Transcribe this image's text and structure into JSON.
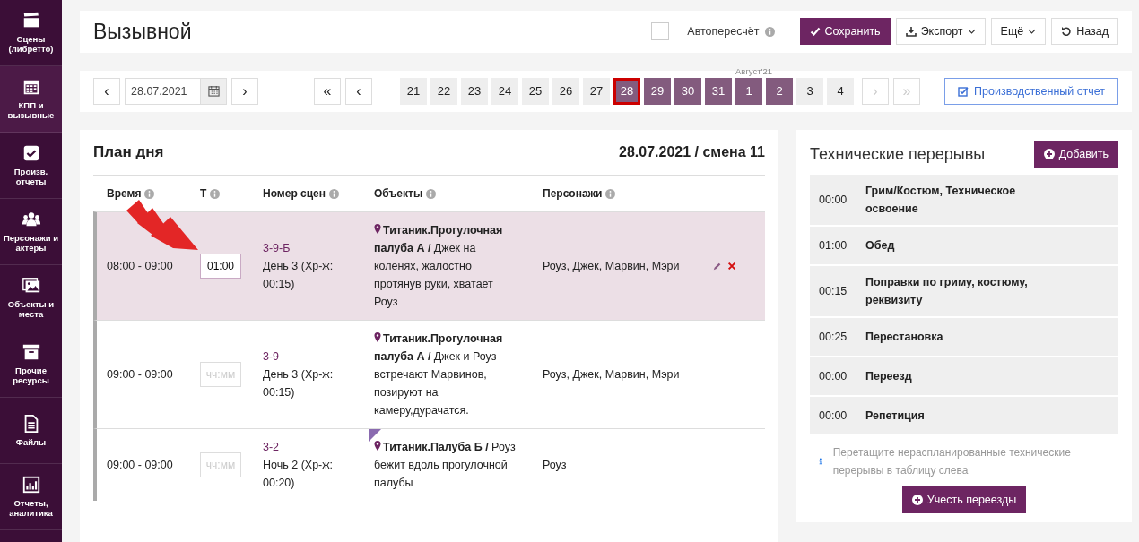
{
  "sidebar": {
    "items": [
      {
        "label": "Сцены (либретто)",
        "selected": false
      },
      {
        "label": "КПП и вызывные",
        "selected": true
      },
      {
        "label": "Произв. отчеты",
        "selected": false
      },
      {
        "label": "Персонажи и актеры",
        "selected": false
      },
      {
        "label": "Объекты и места",
        "selected": false
      },
      {
        "label": "Прочие ресурсы",
        "selected": false
      },
      {
        "label": "Файлы",
        "selected": false
      },
      {
        "label": "Отчеты, аналитика",
        "selected": false
      }
    ]
  },
  "header": {
    "title": "Вызывной",
    "autorecalc": {
      "label": "Автопересчёт",
      "checked": false
    },
    "buttons": [
      {
        "kind": "save",
        "label": "Сохранить"
      },
      {
        "kind": "export",
        "label": "Экспорт"
      },
      {
        "kind": "more",
        "label": "Ещё"
      },
      {
        "kind": "back",
        "label": "Назад"
      }
    ]
  },
  "datebar": {
    "prev": "‹",
    "date": "28.07.2021",
    "next": "›",
    "first": "«",
    "page_prev": "‹",
    "page_next": {
      "label": "›",
      "disabled": true
    },
    "last": {
      "label": "»",
      "disabled": true
    },
    "days": [
      {
        "label": "21",
        "scheduled": false,
        "selected": false
      },
      {
        "label": "22",
        "scheduled": false,
        "selected": false
      },
      {
        "label": "23",
        "scheduled": false,
        "selected": false
      },
      {
        "label": "24",
        "scheduled": false,
        "selected": false
      },
      {
        "label": "25",
        "scheduled": false,
        "selected": false
      },
      {
        "label": "26",
        "scheduled": false,
        "selected": false
      },
      {
        "label": "27",
        "scheduled": false,
        "selected": false
      },
      {
        "label": "28",
        "scheduled": true,
        "selected": true
      },
      {
        "label": "29",
        "scheduled": true,
        "selected": false
      },
      {
        "label": "30",
        "scheduled": true,
        "selected": false
      },
      {
        "label": "31",
        "scheduled": true,
        "selected": false
      },
      {
        "label": "1",
        "scheduled": true,
        "selected": false,
        "month": "Август'21"
      },
      {
        "label": "2",
        "scheduled": true,
        "selected": false
      },
      {
        "label": "3",
        "scheduled": false,
        "selected": false
      },
      {
        "label": "4",
        "scheduled": false,
        "selected": false
      }
    ],
    "report": "Производственный отчет"
  },
  "plan": {
    "title": "План дня",
    "subtitle": "28.07.2021 / смена 11",
    "columns": [
      "Время",
      "Т",
      "Номер сцен",
      "Объекты",
      "Персонажи"
    ],
    "rows": [
      {
        "time": "08:00 - 09:00",
        "duration": {
          "value": "01:00"
        },
        "scene": "3-9-Б",
        "day": "День 3 (Хр-ж: 00:15)",
        "object": "**Титаник.Прогулочная палуба А /** Джек на коленях, жалостно протянув руки, хватает Роуз",
        "characters": "Роуз, Джек, Марвин, Мэри",
        "selected": true,
        "flagged": false,
        "actions": true
      },
      {
        "time": "09:00 - 09:00",
        "duration": {
          "placeholder": "чч:мм"
        },
        "scene": "3-9",
        "day": "День 3 (Хр-ж: 00:15)",
        "object": "**Титаник.Прогулочная палуба А /** Джек и Роуз встречают Марвинов, позируют на камеру,дурачатся.",
        "characters": "Роуз, Джек, Марвин, Мэри",
        "selected": false,
        "flagged": false,
        "actions": false
      },
      {
        "time": "09:00 - 09:00",
        "duration": {
          "placeholder": "чч:мм"
        },
        "scene": "3-2",
        "day": "Ночь 2 (Хр-ж: 00:20)",
        "object": "**Титаник.Палуба Б /** Роуз бежит вдоль прогулочной палубы",
        "characters": "Роуз",
        "selected": false,
        "flagged": true,
        "actions": false
      }
    ]
  },
  "breaks": {
    "title": "Технические перерывы",
    "add": "Добавить",
    "items": [
      {
        "time": "00:00",
        "label": "Грим/Костюм, Техническое освоение"
      },
      {
        "time": "01:00",
        "label": "Обед"
      },
      {
        "time": "00:15",
        "label": "Поправки по гриму, костюму, реквизиту"
      },
      {
        "time": "00:25",
        "label": "Перестановка"
      },
      {
        "time": "00:00",
        "label": "Переезд"
      },
      {
        "time": "00:00",
        "label": "Репетиция"
      }
    ],
    "hint": "Перетащите нераспланированные технические перерывы в таблицу слева",
    "button": "Учесть переезды"
  }
}
